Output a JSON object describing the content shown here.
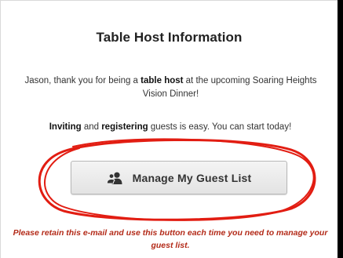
{
  "header": {
    "title": "Table Host Information"
  },
  "intro": {
    "prefix": "Jason, thank you for being a ",
    "bold": "table host",
    "suffix": " at the upcoming Soaring Heights Vision Dinner!"
  },
  "invite": {
    "bold1": "Inviting",
    "mid": " and ",
    "bold2": "registering",
    "suffix": " guests is easy. You can start today!"
  },
  "button": {
    "label": "Manage My Guest List",
    "icon": "users-icon"
  },
  "annotation": {
    "color": "#e21d12"
  },
  "note": {
    "text": "Please retain this e-mail and use this button each time you need to manage your guest list.",
    "color": "#b32a18"
  }
}
